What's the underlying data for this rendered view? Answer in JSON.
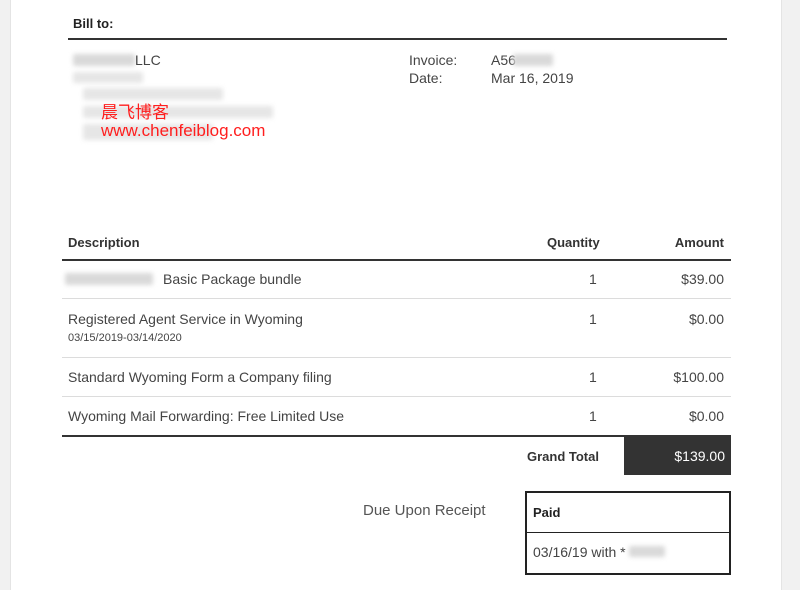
{
  "bill_to": {
    "label": "Bill to:",
    "company_suffix": "LLC"
  },
  "invoice_meta": {
    "invoice_label": "Invoice:",
    "invoice_value": "A56",
    "date_label": "Date:",
    "date_value": "Mar 16, 2019"
  },
  "watermark": {
    "line1": "晨飞博客",
    "line2": "www.chenfeiblog.com"
  },
  "table": {
    "headers": {
      "description": "Description",
      "quantity": "Quantity",
      "amount": "Amount"
    },
    "rows": [
      {
        "description": "Basic Package bundle",
        "quantity": "1",
        "amount": "$39.00"
      },
      {
        "description": "Registered Agent Service in Wyoming",
        "subtext": "03/15/2019-03/14/2020",
        "quantity": "1",
        "amount": "$0.00"
      },
      {
        "description": "Standard Wyoming Form a Company filing",
        "quantity": "1",
        "amount": "$100.00"
      },
      {
        "description": "Wyoming Mail Forwarding: Free Limited Use",
        "quantity": "1",
        "amount": "$0.00"
      }
    ]
  },
  "grand_total": {
    "label": "Grand Total",
    "value": "$139.00"
  },
  "terms": "Due Upon Receipt",
  "payment": {
    "status": "Paid",
    "detail": "03/16/19 with *"
  },
  "colors": {
    "rule": "#333333",
    "watermark": "#ff1e1e",
    "total_background": "#333333"
  }
}
